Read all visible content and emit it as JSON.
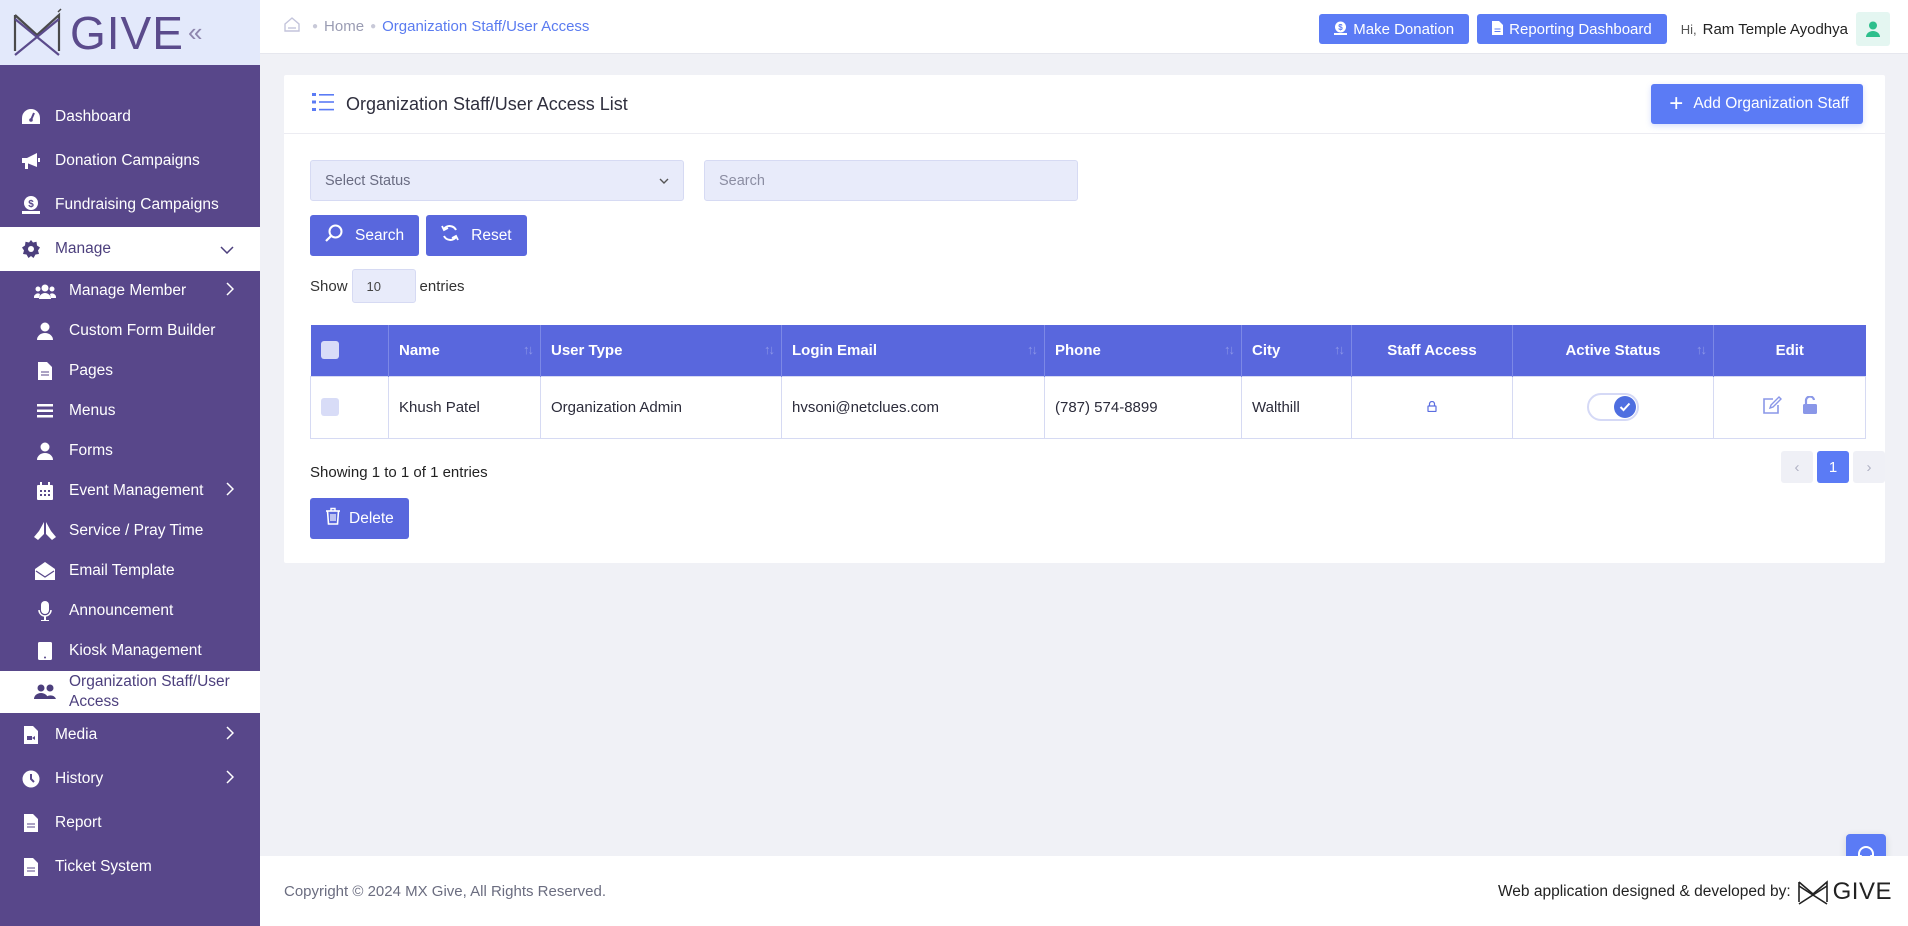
{
  "brand": {
    "logo_text": "GIVE",
    "collapse_icon": "double-chevron-left"
  },
  "sidebar": {
    "items": [
      {
        "label": "Dashboard",
        "icon": "gauge-icon"
      },
      {
        "label": "Donation Campaigns",
        "icon": "megaphone-icon"
      },
      {
        "label": "Fundraising Campaigns",
        "icon": "money-hand-icon"
      },
      {
        "label": "Manage",
        "icon": "gear-icon",
        "expanded": true
      }
    ],
    "manage_children": [
      {
        "label": "Manage Member",
        "icon": "users-icon",
        "has_children": true
      },
      {
        "label": "Custom Form Builder",
        "icon": "user-icon"
      },
      {
        "label": "Pages",
        "icon": "file-icon"
      },
      {
        "label": "Menus",
        "icon": "bars-icon"
      },
      {
        "label": "Forms",
        "icon": "user-icon"
      },
      {
        "label": "Event Management",
        "icon": "calendar-icon",
        "has_children": true
      },
      {
        "label": "Service / Pray Time",
        "icon": "praying-hands-icon"
      },
      {
        "label": "Email Template",
        "icon": "envelope-open-icon"
      },
      {
        "label": "Announcement",
        "icon": "microphone-icon"
      },
      {
        "label": "Kiosk Management",
        "icon": "tablet-icon"
      },
      {
        "label": "Organization Staff/User Access",
        "icon": "user-group-icon",
        "active": true
      }
    ],
    "bottom_items": [
      {
        "label": "Media",
        "icon": "file-video-icon",
        "has_children": true
      },
      {
        "label": "History",
        "icon": "clock-icon",
        "has_children": true
      },
      {
        "label": "Report",
        "icon": "file-icon"
      },
      {
        "label": "Ticket System",
        "icon": "file-icon"
      }
    ]
  },
  "header": {
    "breadcrumb": {
      "home": "Home",
      "current": "Organization Staff/User Access"
    },
    "make_donation": "Make Donation",
    "reporting_dashboard": "Reporting Dashboard",
    "greeting": "Hi,",
    "username": "Ram Temple Ayodhya"
  },
  "page": {
    "title": "Organization Staff/User Access List",
    "add_button": "Add Organization Staff",
    "filters": {
      "status_placeholder": "Select Status",
      "search_placeholder": "Search",
      "search_button": "Search",
      "reset_button": "Reset"
    },
    "length": {
      "show": "Show",
      "value": "10",
      "entries": "entries"
    },
    "table": {
      "columns": [
        "Name",
        "User Type",
        "Login Email",
        "Phone",
        "City",
        "Staff Access",
        "Active Status",
        "Edit"
      ],
      "rows": [
        {
          "name": "Khush Patel",
          "user_type": "Organization Admin",
          "email": "hvsoni@netclues.com",
          "phone": "(787) 574-8899",
          "city": "Walthill",
          "staff_access_icon": "lock-icon",
          "active": true
        }
      ]
    },
    "info": "Showing 1 to 1 of 1 entries",
    "delete_button": "Delete",
    "pagination": {
      "prev": "‹",
      "current": "1",
      "next": "›"
    }
  },
  "footer": {
    "copyright": "Copyright © 2024 MX Give, All Rights Reserved.",
    "credit": "Web application designed & developed by:",
    "credit_brand": "GIVE"
  },
  "colors": {
    "sidebar_bg": "#58478a",
    "primary": "#5b7bf5",
    "table_header": "#5967dd",
    "logo_bar": "#e3e9fb"
  }
}
